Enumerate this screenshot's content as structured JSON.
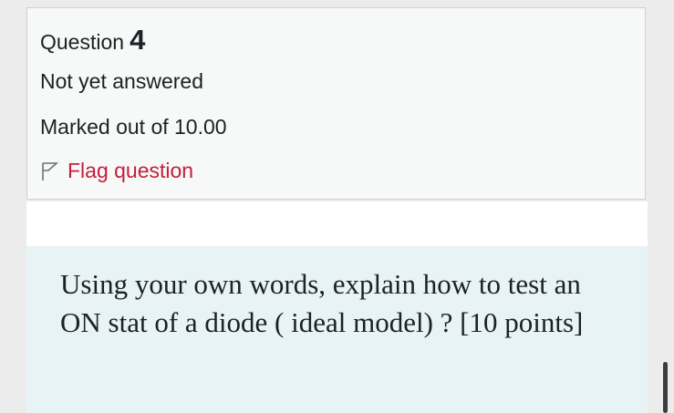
{
  "question_info": {
    "prefix": "Question",
    "number": "4",
    "state": "Not yet answered",
    "grade": "Marked out of 10.00",
    "flag_label": "Flag question"
  },
  "question": {
    "text": "Using your own words, explain how to test an ON stat of a diode ( ideal model) ? [10 points]"
  },
  "icons": {
    "flag": "flag-outline-icon"
  },
  "colors": {
    "flag_link": "#c41f3a",
    "info_background": "#f7f8f8",
    "question_background": "#e7f3f5",
    "text": "#1d2125"
  }
}
